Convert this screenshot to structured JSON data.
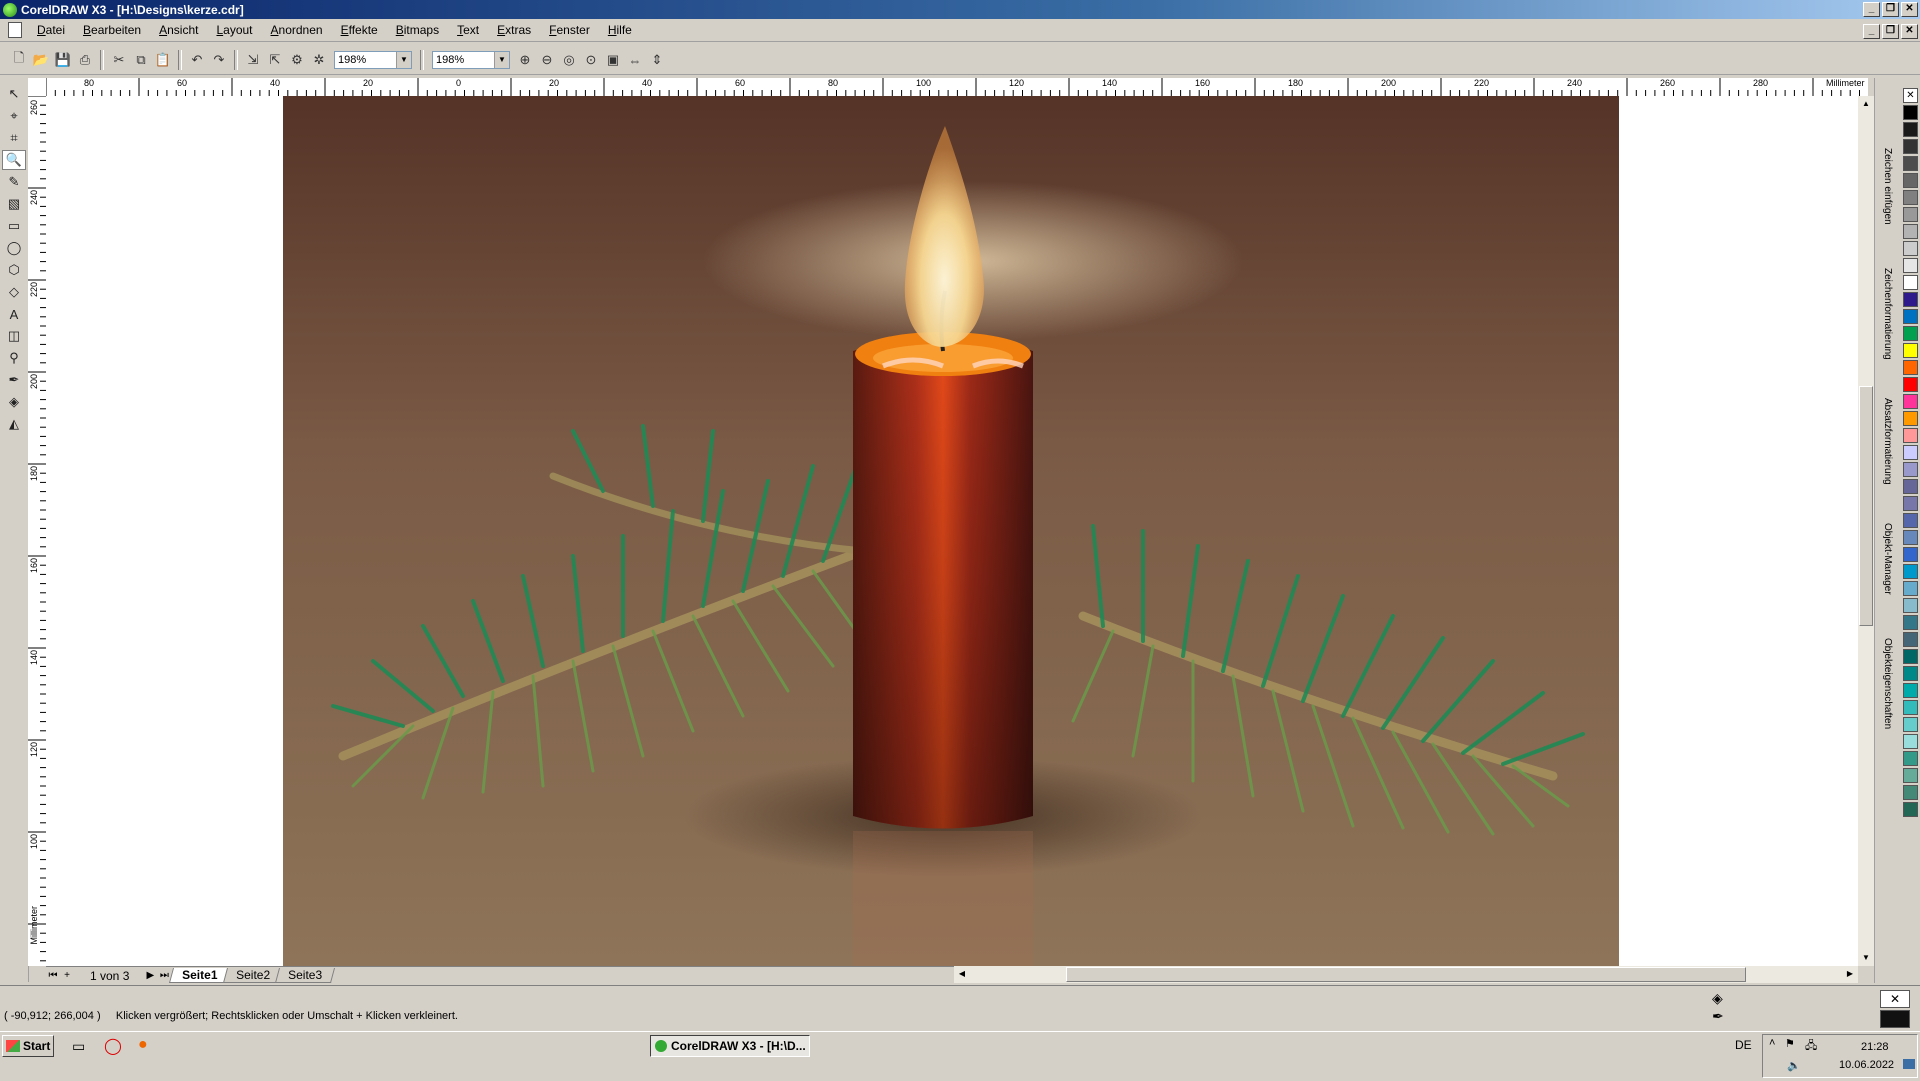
{
  "window": {
    "title": "CorelDRAW X3 - [H:\\Designs\\kerze.cdr]",
    "min": "_",
    "max": "❐",
    "close": "✕"
  },
  "menu": [
    "Datei",
    "Bearbeiten",
    "Ansicht",
    "Layout",
    "Anordnen",
    "Effekte",
    "Bitmaps",
    "Text",
    "Extras",
    "Fenster",
    "Hilfe"
  ],
  "toolbar": {
    "zoom1": "198%",
    "zoom2": "198%"
  },
  "ruler": {
    "unit": "Millimeter",
    "h_labels": [
      "80",
      "60",
      "40",
      "20",
      "0",
      "20",
      "40",
      "60",
      "80",
      "100",
      "120",
      "140",
      "160",
      "180",
      "200",
      "220",
      "240",
      "260",
      "280"
    ],
    "v_labels": [
      "260",
      "240",
      "220",
      "200",
      "180",
      "160",
      "140",
      "120",
      "100"
    ]
  },
  "pages": {
    "count": "1 von 3",
    "tabs": [
      "Seite1",
      "Seite2",
      "Seite3"
    ],
    "active": 0
  },
  "dockers": [
    "Zeichen einfügen",
    "Zeichenformatierung",
    "Absatzformatierung",
    "Objekt-Manager",
    "Objekteigenschaften"
  ],
  "palette": [
    "#000000",
    "#1a1a1a",
    "#333333",
    "#4d4d4d",
    "#666666",
    "#808080",
    "#999999",
    "#b3b3b3",
    "#cccccc",
    "#e6e6e6",
    "#ffffff",
    "#2e1a8a",
    "#0070c0",
    "#00a050",
    "#ffff00",
    "#ff6600",
    "#ff0000",
    "#ff3399",
    "#ff9900",
    "#ff9999",
    "#ccccff",
    "#9999cc",
    "#666699",
    "#7777aa",
    "#5566aa",
    "#6688bb",
    "#3366cc",
    "#0099cc",
    "#66aacc",
    "#88bbcc",
    "#337788",
    "#446677",
    "#006666",
    "#008888",
    "#00aaaa",
    "#33bbbb",
    "#66cccc",
    "#99dddd",
    "#339988",
    "#66aa99",
    "#448877",
    "#226655"
  ],
  "status": {
    "coords": "( -90,912; 266,004 )",
    "message": "Klicken vergrößert; Rechtsklicken oder Umschalt + Klicken verkleinert."
  },
  "taskbar": {
    "start": "Start",
    "task": "CorelDRAW X3 - [H:\\D...",
    "lang": "DE",
    "time": "21:28",
    "date": "10.06.2022"
  }
}
